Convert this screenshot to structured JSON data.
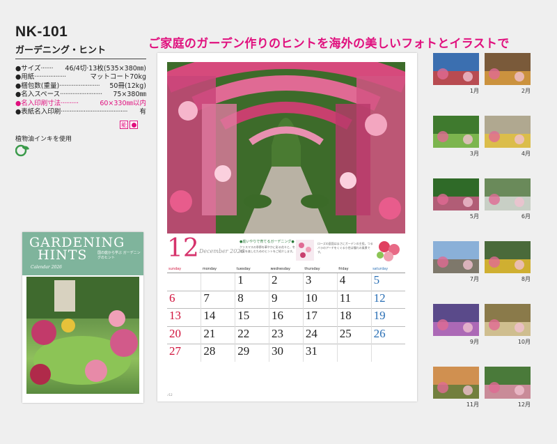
{
  "product": {
    "code": "NK-101",
    "name": "ガーデニング・ヒント"
  },
  "specs": [
    {
      "label": "●サイズ",
      "dots": "·······",
      "value": "46/4切·13枚(535×380㎜)",
      "highlight": false
    },
    {
      "label": "●用紙",
      "dots": "··················",
      "value": "マットコート70kg",
      "highlight": false
    },
    {
      "label": "●梱包数(重量)",
      "dots": "·······················",
      "value": "50冊(12kg)",
      "highlight": false
    },
    {
      "label": "●名入スペース",
      "dots": "························",
      "value": "75×380㎜",
      "highlight": false
    },
    {
      "label": "●名入印刷寸法",
      "dots": "··········",
      "value": "60×330㎜以内",
      "highlight": true
    },
    {
      "label": "●表紙名入印刷",
      "dots": "······································",
      "value": "有",
      "highlight": false
    }
  ],
  "badge_label": "能",
  "ink_note": "植物油インキを使用",
  "headline": "ご家庭のガーデン作りのヒントを海外の美しいフォトとイラストで",
  "cover": {
    "title_line1": "GARDENING",
    "title_line2": "HINTS",
    "subtitle": "Calendar 2026",
    "note": "国の庭から学ぶ ガーデニングのヒント"
  },
  "calendar": {
    "month": "12",
    "month_en": "December 2026",
    "tip_title": "●庭いやりで育てるガーデニング●",
    "tip_text": "クリスマスの季節を華やかに彩る花々と、冬の庭を楽しむためのヒントをご紹介します。",
    "tip_text2": "ローズの庭園はまさにガーデンの主役。つるバラのアーチをくぐる小径は憧れの風景です。",
    "weekdays": [
      "sunday",
      "monday",
      "tuesday",
      "wednesday",
      "thursday",
      "friday",
      "saturday"
    ],
    "weeks": [
      [
        "",
        "",
        "1",
        "2",
        "3",
        "4",
        "5"
      ],
      [
        "6",
        "7",
        "8",
        "9",
        "10",
        "11",
        "12"
      ],
      [
        "13",
        "14",
        "15",
        "16",
        "17",
        "18",
        "19"
      ],
      [
        "20",
        "21",
        "22",
        "23",
        "24",
        "25",
        "26"
      ],
      [
        "27",
        "28",
        "29",
        "30",
        "31",
        "",
        ""
      ]
    ],
    "page_no": "♪12"
  },
  "months": [
    {
      "label": "1月"
    },
    {
      "label": "2月"
    },
    {
      "label": "3月"
    },
    {
      "label": "4月"
    },
    {
      "label": "5月"
    },
    {
      "label": "6月"
    },
    {
      "label": "7月"
    },
    {
      "label": "8月"
    },
    {
      "label": "9月"
    },
    {
      "label": "10月"
    },
    {
      "label": "11月"
    },
    {
      "label": "12月"
    }
  ],
  "colors": {
    "accent": "#e0107e",
    "sunday": "#d0103a",
    "saturday": "#2a6fb5",
    "cover_green": "#7fb49c"
  }
}
